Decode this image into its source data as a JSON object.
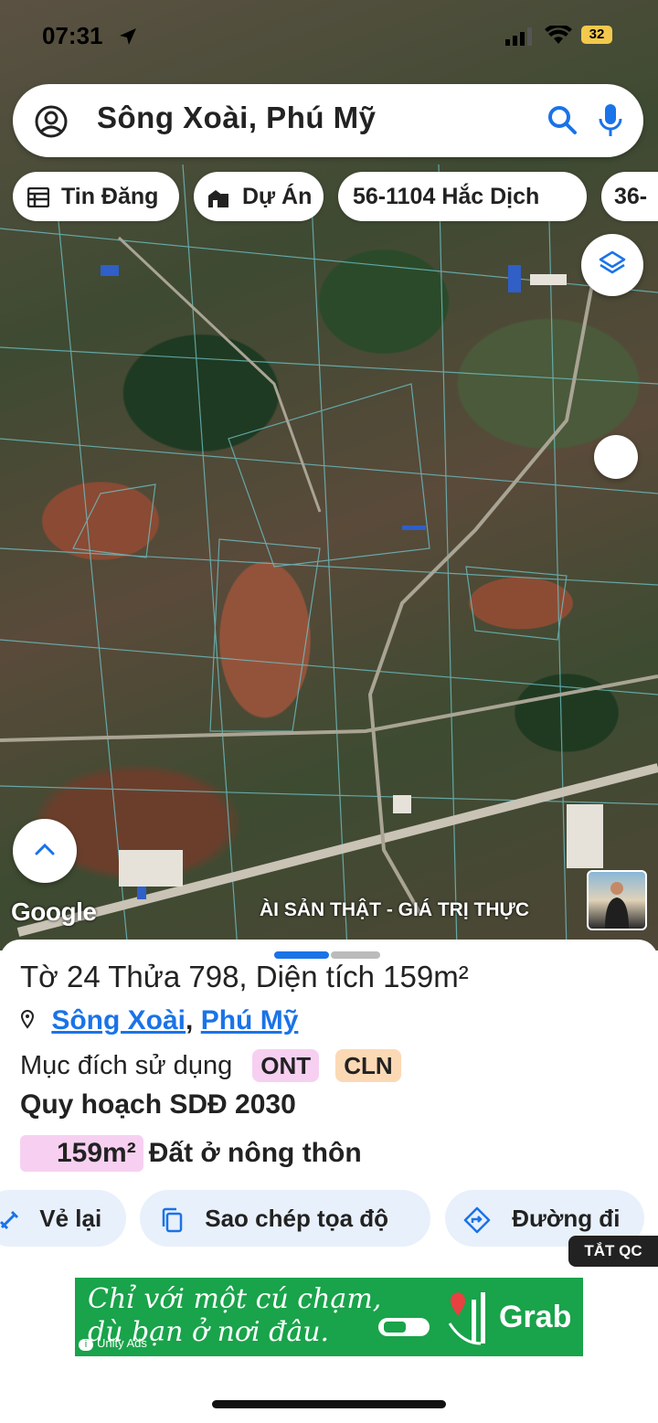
{
  "status_bar": {
    "time": "07:31",
    "battery": "32"
  },
  "search": {
    "query": "Sông Xoài, Phú Mỹ"
  },
  "chips": [
    {
      "label": "Tin Đăng",
      "icon": "table-icon"
    },
    {
      "label": "Dự Án",
      "icon": "building-icon"
    },
    {
      "label": "56-1104 Hắc Dịch"
    },
    {
      "label": "36-"
    }
  ],
  "map": {
    "google_label": "Google",
    "watermark": "ÀI SẢN THẬT - GIÁ TRỊ THỰC"
  },
  "parcel": {
    "title": "Tờ 24 Thửa 798, Diện tích 159m²",
    "address_part1": "Sông Xoài",
    "address_sep": ",",
    "address_part2": "Phú Mỹ",
    "purpose_label": "Mục đích sử dụng",
    "tags": [
      {
        "code": "ONT",
        "color": "#f7d0f1"
      },
      {
        "code": "CLN",
        "color": "#fbd9b5"
      }
    ],
    "plan_title": "Quy hoạch SDĐ 2030",
    "area_value": "159m²",
    "area_type": "Đất ở nông thôn"
  },
  "actions": {
    "redraw": "Vẻ lại",
    "copy_coords": "Sao chép tọa độ",
    "directions": "Đường đi"
  },
  "ad": {
    "close_label": "TẮT QC",
    "line1": "Chỉ với một cú chạm,",
    "line2": "dù bạn ở nơi đâu.",
    "brand": "Grab",
    "network": "Unity Ads"
  },
  "colors": {
    "accent": "#1a73e8",
    "action_bg": "#e8f0fb",
    "ad_bg": "#19a34a"
  }
}
